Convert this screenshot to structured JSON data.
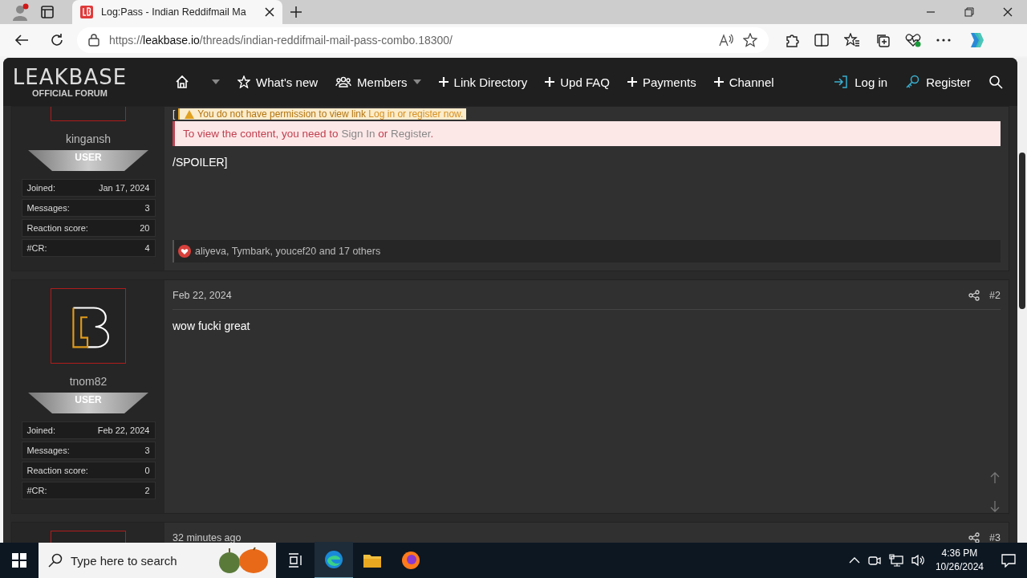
{
  "browser": {
    "tabs": [
      {
        "title": "Log:Pass - Indian Reddifmail Ma",
        "selected": true
      }
    ],
    "url": {
      "scheme": "https://",
      "domain": "leakbase.io",
      "path": "/threads/indian-reddifmail-mail-pass-combo.18300/"
    }
  },
  "header": {
    "logo": {
      "title": "LEAKBASE",
      "subtitle": "OFFICIAL FORUM"
    },
    "nav": [
      {
        "kind": "home",
        "dropdown": true
      },
      {
        "kind": "star",
        "label": "What's new",
        "dropdown": false
      },
      {
        "kind": "people",
        "label": "Members",
        "dropdown": true
      },
      {
        "kind": "plus",
        "label": "Link Directory",
        "dropdown": false
      },
      {
        "kind": "plus",
        "label": "Upd FAQ",
        "dropdown": false
      },
      {
        "kind": "plus",
        "label": "Payments",
        "dropdown": false
      },
      {
        "kind": "plus",
        "label": "Channel",
        "dropdown": false
      }
    ],
    "actions": [
      {
        "kind": "login",
        "label": "Log in"
      },
      {
        "kind": "key",
        "label": "Register"
      },
      {
        "kind": "search"
      }
    ]
  },
  "posts": [
    {
      "kind": "top-cut",
      "user": "kingansh",
      "rank": "USER",
      "stats": [
        {
          "label": "Joined:",
          "value": "Jan 17, 2024"
        },
        {
          "label": "Messages:",
          "value": "3"
        },
        {
          "label": "Reaction score:",
          "value": "20"
        },
        {
          "label": "#CR:",
          "value": "4"
        }
      ],
      "bracket": "[",
      "warning": {
        "text": "You do not have permission to view link ",
        "link": "Log in or register now."
      },
      "notice": {
        "text": "To view the content, you need to ",
        "link1": "Sign In",
        "middle": " or ",
        "link2": "Register",
        "end": "."
      },
      "body": "/SPOILER]",
      "reactions": "aliyeva, Tymbark, youcef20 and 17 others"
    },
    {
      "kind": "full",
      "user": "tnom82",
      "rank": "USER",
      "stats": [
        {
          "label": "Joined:",
          "value": "Feb 22, 2024"
        },
        {
          "label": "Messages:",
          "value": "3"
        },
        {
          "label": "Reaction score:",
          "value": "0"
        },
        {
          "label": "#CR:",
          "value": "2"
        }
      ],
      "date": "Feb 22, 2024",
      "number": "#2",
      "body": "wow fucki great"
    },
    {
      "kind": "bottom-cut",
      "date": "32 minutes ago",
      "number": "#3"
    }
  ],
  "taskbar": {
    "search": {
      "placeholder": "Type here to search"
    },
    "time": "4:36 PM",
    "date": "10/26/2024"
  }
}
